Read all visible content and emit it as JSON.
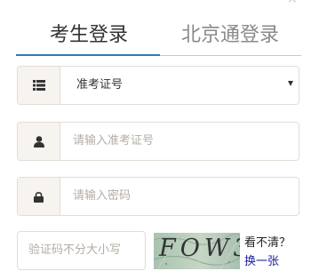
{
  "tabs": [
    {
      "label": "考生登录",
      "active": true
    },
    {
      "label": "北京通登录",
      "active": false
    }
  ],
  "fields": {
    "id_type": {
      "value": "准考证号",
      "icon": "list-icon"
    },
    "exam_number": {
      "placeholder": "请输入准考证号",
      "icon": "user-icon"
    },
    "password": {
      "placeholder": "请输入密码",
      "icon": "lock-icon"
    },
    "captcha": {
      "placeholder": "验证码不分大小写"
    }
  },
  "captcha": {
    "image_text": "FOW3",
    "unclear_label": "看不清？",
    "refresh_label": "换一张"
  },
  "colors": {
    "accent": "#337ab7",
    "addon_bg": "#f7f3ee",
    "border": "#e3dcd5"
  }
}
